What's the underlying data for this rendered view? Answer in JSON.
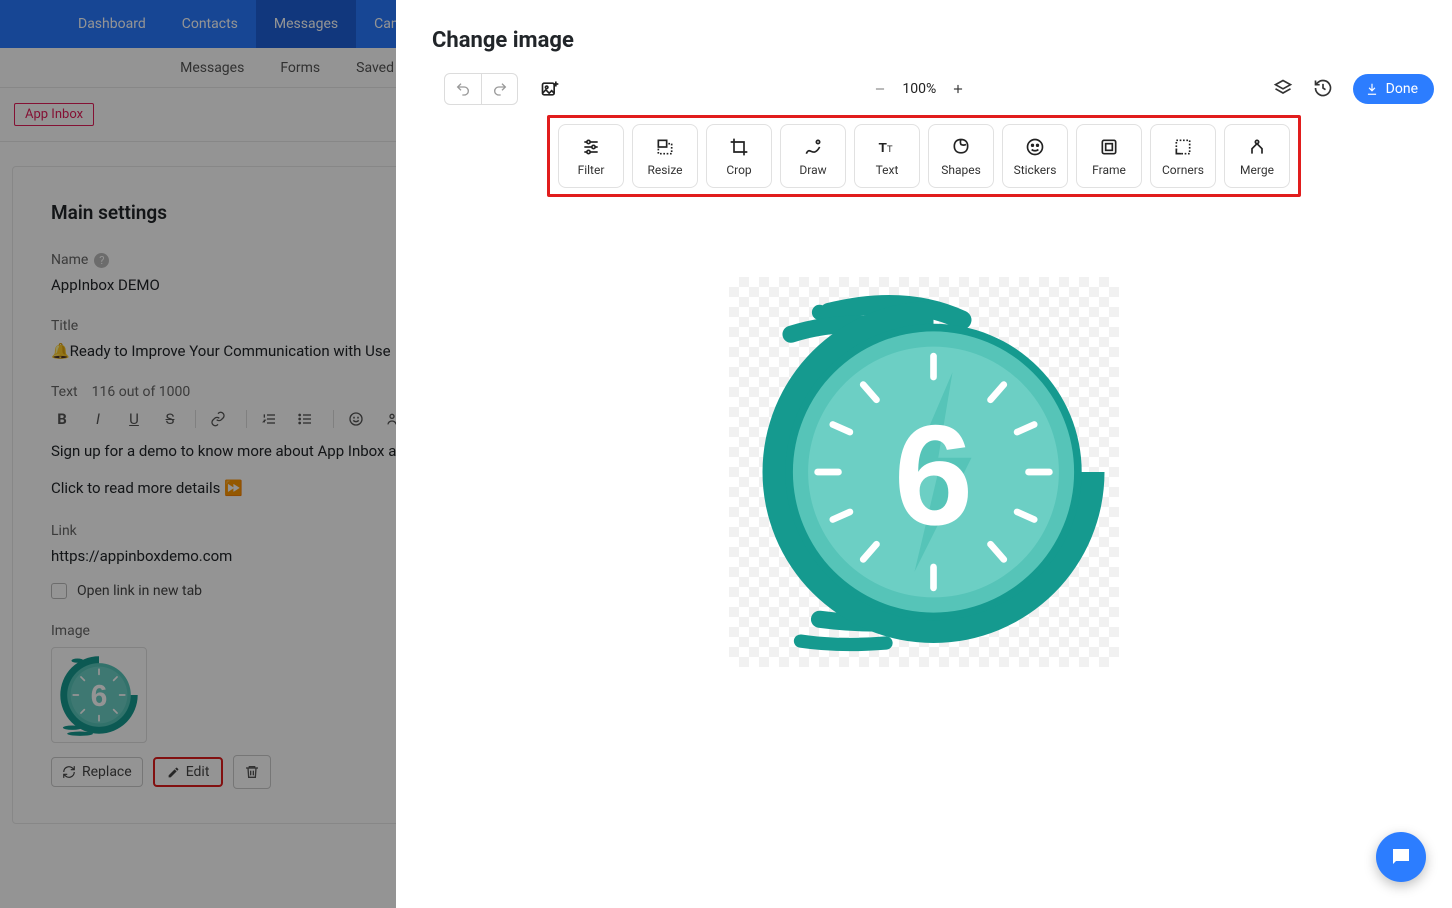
{
  "nav": {
    "items": [
      "Dashboard",
      "Contacts",
      "Messages",
      "Campaigns"
    ],
    "active_index": 2,
    "sub": [
      "Messages",
      "Forms",
      "Saved"
    ]
  },
  "chip": {
    "label": "App Inbox"
  },
  "panel": {
    "heading": "Main settings",
    "name_label": "Name",
    "name_value": "AppInbox DEMO",
    "title_label": "Title",
    "title_value": "🔔Ready to Improve Your Communication with Use",
    "text_label": "Text",
    "text_counter": "116 out of 1000",
    "body_line1": "Sign up for a demo to know more about App Inbox and use it up to six months for free.",
    "body_line2": "Click to read more details ⏩",
    "link_label": "Link",
    "link_value": "https://appinboxdemo.com",
    "open_new_tab": "Open link in new tab",
    "image_label": "Image",
    "replace_label": "Replace",
    "edit_label": "Edit"
  },
  "editor": {
    "title": "Change image",
    "zoom": "100%",
    "done": "Done",
    "tools": [
      {
        "key": "filter",
        "label": "Filter"
      },
      {
        "key": "resize",
        "label": "Resize"
      },
      {
        "key": "crop",
        "label": "Crop"
      },
      {
        "key": "draw",
        "label": "Draw"
      },
      {
        "key": "text",
        "label": "Text"
      },
      {
        "key": "shapes",
        "label": "Shapes"
      },
      {
        "key": "stickers",
        "label": "Stickers"
      },
      {
        "key": "frame",
        "label": "Frame"
      },
      {
        "key": "corners",
        "label": "Corners"
      },
      {
        "key": "merge",
        "label": "Merge"
      }
    ],
    "clock_number": "6"
  }
}
